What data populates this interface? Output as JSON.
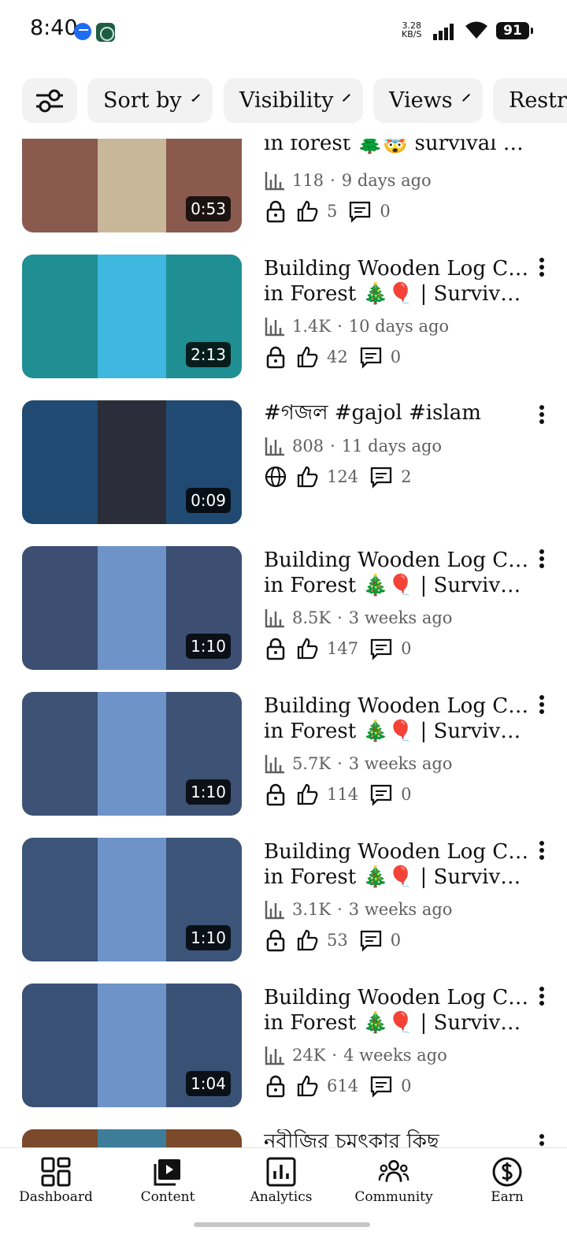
{
  "status_bar": {
    "time": "8:40",
    "net_speed_value": "3.28",
    "net_speed_unit": "KB/S",
    "battery": "91",
    "icons": [
      "messenger-icon",
      "app-notification-icon",
      "signal-icon",
      "wifi-icon",
      "battery-icon"
    ]
  },
  "filters": {
    "filter_icon": "filter-sliders-icon",
    "chips": [
      {
        "label": "Sort by"
      },
      {
        "label": "Visibility"
      },
      {
        "label": "Views"
      },
      {
        "label": "Restr"
      }
    ]
  },
  "videos": [
    {
      "title_line1": "in forest 🌲🤯 survival ho…",
      "title_line2": "",
      "views": "118",
      "age": "9 days ago",
      "likes": "5",
      "comments": "0",
      "visibility": "lock-icon",
      "duration": "0:53",
      "thumb_bg": "#8a5a4f",
      "thumb_inner": "#c9b79a"
    },
    {
      "title_line1": "Building Wooden Log Cabin",
      "title_line2": "in Forest 🎄🎈 | Survival …",
      "views": "1.4K",
      "age": "10 days ago",
      "likes": "42",
      "comments": "0",
      "visibility": "lock-icon",
      "duration": "2:13",
      "thumb_bg": "#1f8f93",
      "thumb_inner": "#3fb8e0"
    },
    {
      "title_line1": "#গজল #gajol #islam",
      "title_line2": "",
      "views": "808",
      "age": "11 days ago",
      "likes": "124",
      "comments": "2",
      "visibility": "globe-icon",
      "duration": "0:09",
      "thumb_bg": "#214a73",
      "thumb_inner": "#2b2e3a"
    },
    {
      "title_line1": "Building Wooden Log Cabin",
      "title_line2": "in Forest 🎄🎈 | Survival …",
      "views": "8.5K",
      "age": "3 weeks ago",
      "likes": "147",
      "comments": "0",
      "visibility": "lock-icon",
      "duration": "1:10",
      "thumb_bg": "#3c4e72",
      "thumb_inner": "#6d93c9"
    },
    {
      "title_line1": "Building Wooden Log Cabin",
      "title_line2": "in Forest 🎄🎈 | Survival …",
      "views": "5.7K",
      "age": "3 weeks ago",
      "likes": "114",
      "comments": "0",
      "visibility": "lock-icon",
      "duration": "1:10",
      "thumb_bg": "#3d5274",
      "thumb_inner": "#6d93c9"
    },
    {
      "title_line1": "Building Wooden Log Cabin",
      "title_line2": "in Forest 🎄🎈 | Survival …",
      "views": "3.1K",
      "age": "3 weeks ago",
      "likes": "53",
      "comments": "0",
      "visibility": "lock-icon",
      "duration": "1:10",
      "thumb_bg": "#3b5477",
      "thumb_inner": "#6d93c9"
    },
    {
      "title_line1": "Building Wooden Log Cabin",
      "title_line2": "in Forest 🎄🎈 | Survival …",
      "views": "24K",
      "age": "4 weeks ago",
      "likes": "614",
      "comments": "0",
      "visibility": "lock-icon",
      "duration": "1:04",
      "thumb_bg": "#3a5176",
      "thumb_inner": "#6d93c9"
    },
    {
      "title_line1": "নবীজির চমৎকার কিছু",
      "title_line2": "",
      "views": "",
      "age": "",
      "likes": "",
      "comments": "",
      "visibility": "",
      "duration": "",
      "thumb_bg": "#7a4a2a",
      "thumb_inner": "#3d7d9a"
    }
  ],
  "bottom_nav": [
    {
      "label": "Dashboard",
      "icon": "dashboard-icon"
    },
    {
      "label": "Content",
      "icon": "content-icon"
    },
    {
      "label": "Analytics",
      "icon": "analytics-icon"
    },
    {
      "label": "Community",
      "icon": "community-icon"
    },
    {
      "label": "Earn",
      "icon": "earn-icon"
    }
  ]
}
